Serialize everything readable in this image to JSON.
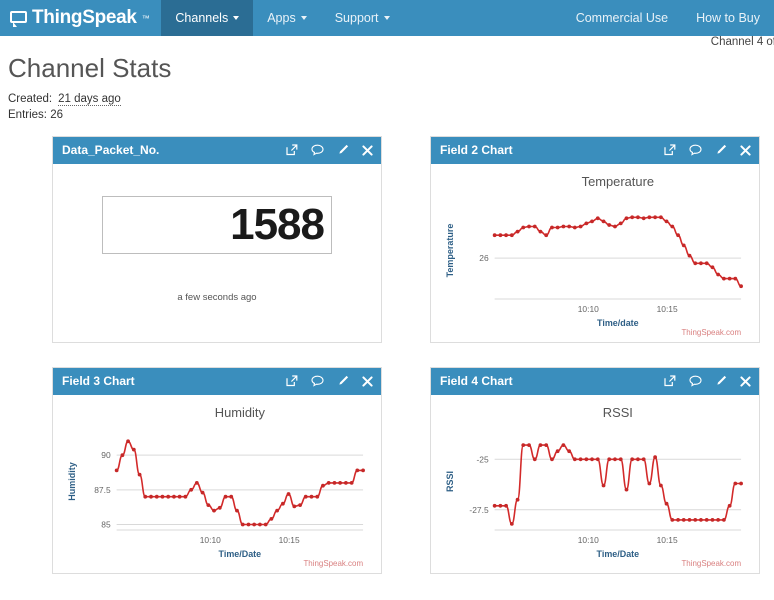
{
  "navbar": {
    "brand": "ThingSpeak",
    "brand_tm": "™",
    "logo_icon": "speech-bubble-icon",
    "items": [
      {
        "label": "Channels",
        "has_caret": true,
        "active": true
      },
      {
        "label": "Apps",
        "has_caret": true,
        "active": false
      },
      {
        "label": "Support",
        "has_caret": true,
        "active": false
      }
    ],
    "right_items": [
      {
        "label": "Commercial Use"
      },
      {
        "label": "How to Buy"
      }
    ],
    "background": "#3a8ebd",
    "active_background": "#2b6d94"
  },
  "subbar": {
    "channel_count": "Channel 4 of"
  },
  "page": {
    "title": "Channel Stats",
    "created_label": "Created:",
    "created_value": "21 days ago",
    "entries_label": "Entries:",
    "entries_value": "26"
  },
  "widget_icons": [
    {
      "name": "export-icon",
      "title": "export"
    },
    {
      "name": "comment-icon",
      "title": "comment"
    },
    {
      "name": "edit-pencil-icon",
      "title": "edit"
    },
    {
      "name": "close-icon",
      "title": "close"
    }
  ],
  "widgets": [
    {
      "id": "data-packet-no",
      "header": "Data_Packet_No.",
      "type": "numeric",
      "value": "1588",
      "timestamp": "a few seconds ago"
    },
    {
      "id": "field-2-chart",
      "header": "Field 2 Chart",
      "type": "chart"
    },
    {
      "id": "field-3-chart",
      "header": "Field 3 Chart",
      "type": "chart"
    },
    {
      "id": "field-4-chart",
      "header": "Field 4 Chart",
      "type": "chart"
    }
  ],
  "watermark": "ThingSpeak.com",
  "colors": {
    "brand_blue": "#3a8ebd",
    "series_red": "#c62828",
    "axis_title_blue": "#2e5f86"
  },
  "chart_data": [
    {
      "id": "temperature",
      "type": "line",
      "title": "Temperature",
      "xlabel": "Time/date",
      "ylabel": "Temperature",
      "grid": true,
      "legend": false,
      "xticks": [
        "10:10",
        "10:15"
      ],
      "xtick_positions": [
        0.38,
        0.7
      ],
      "yticks": [
        26
      ],
      "ylim": [
        25.2,
        27.1
      ],
      "xlim": [
        0,
        43
      ],
      "x": [
        0,
        1,
        2,
        3,
        4,
        5,
        6,
        7,
        8,
        9,
        10,
        11,
        12,
        13,
        14,
        15,
        16,
        17,
        18,
        19,
        20,
        21,
        22,
        23,
        24,
        25,
        26,
        27,
        28,
        29,
        30,
        31,
        32,
        33,
        34,
        35,
        36,
        37,
        38,
        39,
        40,
        41,
        42,
        43
      ],
      "values": [
        26.45,
        26.45,
        26.45,
        26.45,
        26.52,
        26.6,
        26.62,
        26.62,
        26.52,
        26.45,
        26.6,
        26.6,
        26.62,
        26.62,
        26.6,
        26.62,
        26.68,
        26.72,
        26.78,
        26.72,
        26.65,
        26.62,
        26.68,
        26.78,
        26.8,
        26.8,
        26.78,
        26.8,
        26.8,
        26.8,
        26.72,
        26.62,
        26.45,
        26.25,
        26.05,
        25.9,
        25.9,
        25.9,
        25.82,
        25.68,
        25.6,
        25.6,
        25.6,
        25.45
      ]
    },
    {
      "id": "humidity",
      "type": "line",
      "title": "Humidity",
      "xlabel": "Time/Date",
      "ylabel": "Humidity",
      "grid": true,
      "legend": false,
      "xticks": [
        "10:10",
        "10:15"
      ],
      "xtick_positions": [
        0.38,
        0.7
      ],
      "yticks": [
        85,
        87.5,
        90
      ],
      "ylim": [
        84.6,
        91.6
      ],
      "xlim": [
        0,
        43
      ],
      "x": [
        0,
        1,
        2,
        3,
        4,
        5,
        6,
        7,
        8,
        9,
        10,
        11,
        12,
        13,
        14,
        15,
        16,
        17,
        18,
        19,
        20,
        21,
        22,
        23,
        24,
        25,
        26,
        27,
        28,
        29,
        30,
        31,
        32,
        33,
        34,
        35,
        36,
        37,
        38,
        39,
        40,
        41,
        42,
        43
      ],
      "values": [
        88.9,
        90.0,
        91.0,
        90.4,
        88.6,
        87.0,
        87.0,
        87.0,
        87.0,
        87.0,
        87.0,
        87.0,
        87.0,
        87.5,
        88.0,
        87.3,
        86.4,
        86.0,
        86.2,
        87.0,
        87.0,
        86.0,
        85.0,
        85.0,
        85.0,
        85.0,
        85.0,
        85.4,
        86.0,
        86.5,
        87.2,
        86.3,
        86.4,
        87.0,
        87.0,
        87.0,
        87.8,
        88.0,
        88.0,
        88.0,
        88.0,
        88.0,
        88.9,
        88.9
      ]
    },
    {
      "id": "rssi",
      "type": "line",
      "title": "RSSI",
      "xlabel": "Time/Date",
      "ylabel": "RSSI",
      "grid": true,
      "legend": false,
      "xticks": [
        "10:10",
        "10:15"
      ],
      "xtick_positions": [
        0.38,
        0.7
      ],
      "yticks": [
        -27.5,
        -25
      ],
      "ylim": [
        -28.5,
        -23.7
      ],
      "xlim": [
        0,
        43
      ],
      "x": [
        0,
        1,
        2,
        3,
        4,
        5,
        6,
        7,
        8,
        9,
        10,
        11,
        12,
        13,
        14,
        15,
        16,
        17,
        18,
        19,
        20,
        21,
        22,
        23,
        24,
        25,
        26,
        27,
        28,
        29,
        30,
        31,
        32,
        33,
        34,
        35,
        36,
        37,
        38,
        39,
        40,
        41,
        42,
        43
      ],
      "values": [
        -27.3,
        -27.3,
        -27.3,
        -28.2,
        -27.0,
        -24.3,
        -24.3,
        -25.0,
        -24.3,
        -24.3,
        -25.0,
        -24.6,
        -24.3,
        -24.6,
        -25.0,
        -25.0,
        -25.0,
        -25.0,
        -25.0,
        -26.3,
        -25.0,
        -25.0,
        -25.0,
        -26.5,
        -25.0,
        -25.0,
        -25.0,
        -26.2,
        -24.9,
        -26.3,
        -27.2,
        -28.0,
        -28.0,
        -28.0,
        -28.0,
        -28.0,
        -28.0,
        -28.0,
        -28.0,
        -28.0,
        -28.0,
        -27.3,
        -26.2,
        -26.2
      ]
    }
  ]
}
